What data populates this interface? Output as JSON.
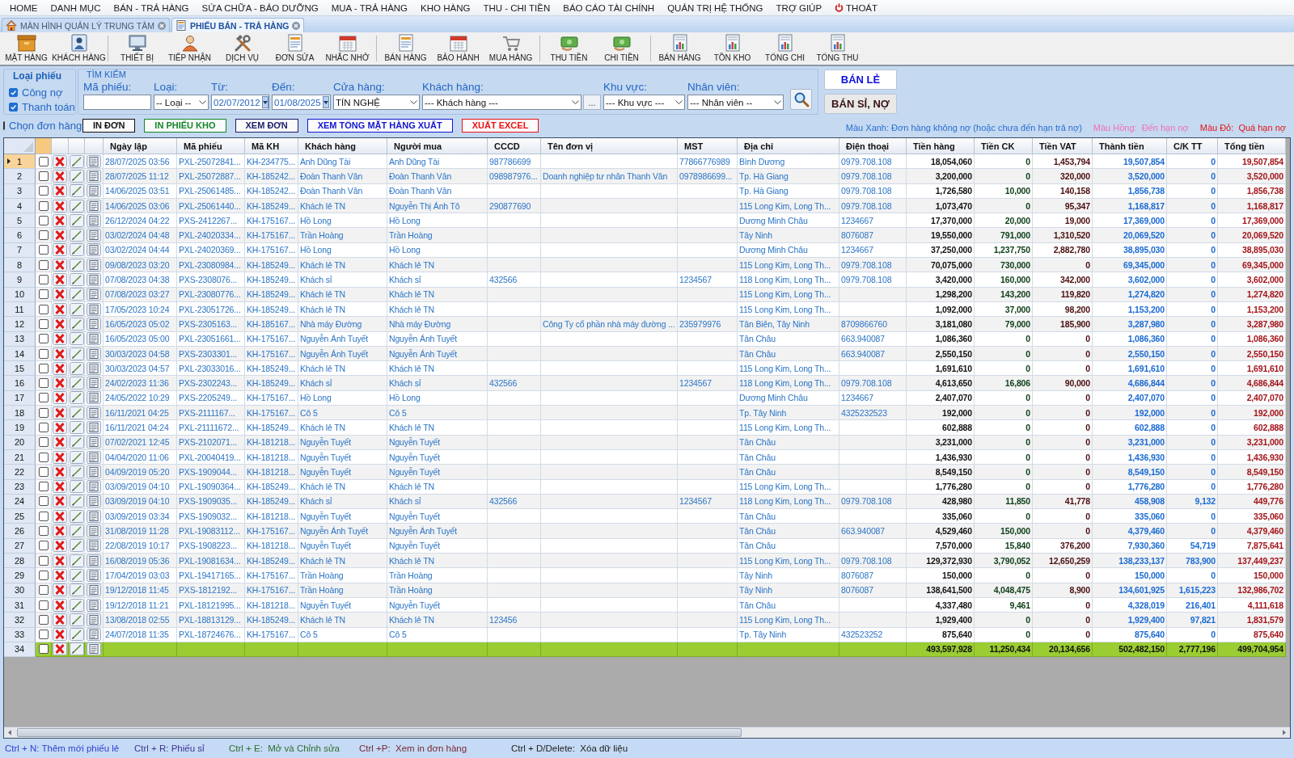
{
  "menu": [
    "HOME",
    "DANH MỤC",
    "BÁN - TRẢ HÀNG",
    "SỬA CHỮA - BẢO DƯỠNG",
    "MUA - TRẢ HÀNG",
    "KHO HÀNG",
    "THU - CHI TIỀN",
    "BÁO CÁO TÀI CHÍNH",
    "QUẢN TRỊ HỆ THỐNG",
    "TRỢ GIÚP"
  ],
  "exit": "THOÁT",
  "tabs": [
    {
      "label": "MÀN HÌNH QUẢN LÝ TRUNG TÂM",
      "selected": false
    },
    {
      "label": "PHIẾU BÁN - TRẢ HÀNG",
      "selected": true
    }
  ],
  "toolbar": [
    [
      "MẶT HÀNG",
      "KHÁCH HÀNG"
    ],
    [
      "THIẾT BỊ",
      "TIẾP NHẬN",
      "DỊCH VỤ",
      "ĐƠN SỬA",
      "NHẮC NHỞ"
    ],
    [
      "BÁN HÀNG",
      "BẢO HÀNH",
      "MUA HÀNG"
    ],
    [
      "THU TIỀN",
      "CHI TIỀN"
    ],
    [
      "BÁN HÀNG",
      "TỒN KHO",
      "TỔNG CHI",
      "TỔNG THU"
    ]
  ],
  "voucher_type": {
    "title": "Loại phiếu",
    "options": [
      {
        "label": "Công nợ",
        "checked": true
      },
      {
        "label": "Thanh toán",
        "checked": true
      }
    ]
  },
  "search": {
    "title": "TÌM KIẾM",
    "fields": [
      {
        "label": "Mã phiếu:",
        "kind": "text"
      },
      {
        "label": "Loại:",
        "kind": "select",
        "value": "-- Loại --"
      },
      {
        "label": "Từ:",
        "kind": "date",
        "value": "02/07/2012"
      },
      {
        "label": "Đến:",
        "kind": "date",
        "value": "01/08/2025"
      },
      {
        "label": "Cửa hàng:",
        "kind": "select",
        "value": "TÍN NGHỆ"
      },
      {
        "label": "Khách hàng:",
        "kind": "select_browse",
        "value": "--- Khách hàng ---",
        "browse": "..."
      },
      {
        "label": "Khu vực:",
        "kind": "select",
        "value": "--- Khu vực ---"
      },
      {
        "label": "Nhân viên:",
        "kind": "select",
        "value": "--- Nhân viên --"
      }
    ]
  },
  "mode_buttons": [
    "BÁN LẺ",
    "BÁN SỈ, NỢ"
  ],
  "select_orders": {
    "label": "Chọn đơn hàng",
    "checked": false
  },
  "actions": [
    {
      "label": "IN ĐƠN",
      "color": "#111111"
    },
    {
      "label": "IN PHIẾU KHO",
      "color": "#12862a"
    },
    {
      "label": "XEM ĐƠN",
      "color": "#1c1c6a"
    },
    {
      "label": "XEM TỔNG MẶT HÀNG XUẤT",
      "color": "#1414d2"
    },
    {
      "label": "XUẤT EXCEL",
      "color": "#ee1111"
    }
  ],
  "legend": [
    {
      "text": "Màu Xanh: Đơn hàng không nợ (hoặc chưa đến hạn trả nợ)",
      "color": "#2a6fd0"
    },
    {
      "text": "Màu Hồng:  Đến hạn nợ",
      "color": "#f070b0"
    },
    {
      "text": "Màu Đỏ:  Quá hạn nợ",
      "color": "#e01414"
    }
  ],
  "columns": [
    "Ngày lập",
    "Mã phiếu",
    "Mã KH",
    "Khách hàng",
    "Người mua",
    "CCCD",
    "Tên đơn vị",
    "MST",
    "Địa chỉ",
    "Điện thoại",
    "Tiền hàng",
    "Tiền CK",
    "Tiền VAT",
    "Thành tiền",
    "C/K TT",
    "Tổng tiền"
  ],
  "rows": [
    {
      "number": "1",
      "selected": true,
      "checked": false,
      "date": "28/07/2025 03:56",
      "voucher": "PXL-25072841...",
      "customer_code": "KH-234775...",
      "customer": "Anh Dũng Tài",
      "buyer": "Anh Dũng Tài",
      "cccd": "987786699",
      "tax_code": "77866776989",
      "address": "Bình Dương",
      "phone": "0979.708.108",
      "goods": "18,054,060",
      "discount": "0",
      "vat": "1,453,794",
      "amount": "19,507,854",
      "pay_discount": "0",
      "total": "19,507,854"
    },
    {
      "number": "2",
      "selected": false,
      "checked": false,
      "date": "28/07/2025 11:12",
      "voucher": "PXL-25072887...",
      "customer_code": "KH-185242...",
      "customer": "Đoàn Thanh Vân",
      "buyer": "Đoàn Thanh Vân",
      "cccd": "098987976...",
      "unit": "Doanh nghiệp tư nhân Thanh Vân",
      "tax_code": "0978986699...",
      "address": "Tp. Hà Giang",
      "phone": "0979.708.108",
      "goods": "3,200,000",
      "discount": "0",
      "vat": "320,000",
      "amount": "3,520,000",
      "pay_discount": "0",
      "total": "3,520,000"
    },
    {
      "number": "3",
      "selected": false,
      "checked": false,
      "date": "14/06/2025 03:51",
      "voucher": "PXL-25061485...",
      "customer_code": "KH-185242...",
      "customer": "Đoàn Thanh Vân",
      "buyer": "Đoàn Thanh Vân",
      "address": "Tp. Hà Giang",
      "phone": "0979.708.108",
      "goods": "1,726,580",
      "discount": "10,000",
      "vat": "140,158",
      "amount": "1,856,738",
      "pay_discount": "0",
      "total": "1,856,738"
    },
    {
      "number": "4",
      "selected": false,
      "checked": false,
      "date": "14/06/2025 03:06",
      "voucher": "PXL-25061440...",
      "customer_code": "KH-185249...",
      "customer": "Khách lẻ TN",
      "buyer": "Nguyễn Thị Ánh Tô",
      "cccd": "290877690",
      "address": "115 Long Kim, Long Th...",
      "phone": "0979.708.108",
      "goods": "1,073,470",
      "discount": "0",
      "vat": "95,347",
      "amount": "1,168,817",
      "pay_discount": "0",
      "total": "1,168,817"
    },
    {
      "number": "5",
      "selected": false,
      "checked": false,
      "date": "26/12/2024 04:22",
      "voucher": "PXS-2412267...",
      "customer_code": "KH-175167...",
      "customer": "Hồ Long",
      "buyer": "Hồ Long",
      "address": "Dương Minh Châu",
      "phone": "1234667",
      "goods": "17,370,000",
      "discount": "20,000",
      "vat": "19,000",
      "amount": "17,369,000",
      "pay_discount": "0",
      "total": "17,369,000"
    },
    {
      "number": "6",
      "selected": false,
      "checked": false,
      "date": "03/02/2024 04:48",
      "voucher": "PXL-24020334...",
      "customer_code": "KH-175167...",
      "customer": "Trần Hoàng",
      "buyer": "Trần Hoàng",
      "address": "Tây Ninh",
      "phone": "8076087",
      "goods": "19,550,000",
      "discount": "791,000",
      "vat": "1,310,520",
      "amount": "20,069,520",
      "pay_discount": "0",
      "total": "20,069,520"
    },
    {
      "number": "7",
      "selected": false,
      "checked": false,
      "date": "03/02/2024 04:44",
      "voucher": "PXL-24020369...",
      "customer_code": "KH-175167...",
      "customer": "Hồ Long",
      "buyer": "Hồ Long",
      "address": "Dương Minh Châu",
      "phone": "1234667",
      "goods": "37,250,000",
      "discount": "1,237,750",
      "vat": "2,882,780",
      "amount": "38,895,030",
      "pay_discount": "0",
      "total": "38,895,030"
    },
    {
      "number": "8",
      "selected": false,
      "checked": false,
      "date": "09/08/2023 03:20",
      "voucher": "PXL-23080984...",
      "customer_code": "KH-185249...",
      "customer": "Khách lẻ TN",
      "buyer": "Khách lẻ TN",
      "address": "115 Long Kim, Long Th...",
      "phone": "0979.708.108",
      "goods": "70,075,000",
      "discount": "730,000",
      "vat": "0",
      "amount": "69,345,000",
      "pay_discount": "0",
      "total": "69,345,000"
    },
    {
      "number": "9",
      "selected": false,
      "checked": false,
      "date": "07/08/2023 04:38",
      "voucher": "PXS-2308076...",
      "customer_code": "KH-185249...",
      "customer": "Khách sỉ",
      "buyer": "Khách sỉ",
      "cccd": "432566",
      "tax_code": "1234567",
      "address": "118 Long Kim, Long Th...",
      "phone": "0979.708.108",
      "goods": "3,420,000",
      "discount": "160,000",
      "vat": "342,000",
      "amount": "3,602,000",
      "pay_discount": "0",
      "total": "3,602,000"
    },
    {
      "number": "10",
      "selected": false,
      "checked": false,
      "date": "07/08/2023 03:27",
      "voucher": "PXL-23080776...",
      "customer_code": "KH-185249...",
      "customer": "Khách lẻ TN",
      "buyer": "Khách lẻ TN",
      "address": "115 Long Kim, Long Th...",
      "goods": "1,298,200",
      "discount": "143,200",
      "vat": "119,820",
      "amount": "1,274,820",
      "pay_discount": "0",
      "total": "1,274,820"
    },
    {
      "number": "11",
      "selected": false,
      "checked": false,
      "date": "17/05/2023 10:24",
      "voucher": "PXL-23051726...",
      "customer_code": "KH-185249...",
      "customer": "Khách lẻ TN",
      "buyer": "Khách lẻ TN",
      "address": "115 Long Kim, Long Th...",
      "goods": "1,092,000",
      "discount": "37,000",
      "vat": "98,200",
      "amount": "1,153,200",
      "pay_discount": "0",
      "total": "1,153,200"
    },
    {
      "number": "12",
      "selected": false,
      "checked": false,
      "date": "16/05/2023 05:02",
      "voucher": "PXS-2305163...",
      "customer_code": "KH-185167...",
      "customer": "Nhà máy Đường",
      "buyer": "Nhà máy Đường",
      "unit": "Công Ty cổ phần nhà máy đường ...",
      "tax_code": "235979976",
      "address": "Tân Biên, Tây Ninh",
      "phone": "8709866760",
      "goods": "3,181,080",
      "discount": "79,000",
      "vat": "185,900",
      "amount": "3,287,980",
      "pay_discount": "0",
      "total": "3,287,980"
    },
    {
      "number": "13",
      "selected": false,
      "checked": false,
      "date": "16/05/2023 05:00",
      "voucher": "PXL-23051661...",
      "customer_code": "KH-175167...",
      "customer": "Nguyễn Ánh Tuyết",
      "buyer": "Nguyễn Ánh Tuyết",
      "address": "Tân Châu",
      "phone": "663.940087",
      "goods": "1,086,360",
      "discount": "0",
      "vat": "0",
      "amount": "1,086,360",
      "pay_discount": "0",
      "total": "1,086,360"
    },
    {
      "number": "14",
      "selected": false,
      "checked": false,
      "date": "30/03/2023 04:58",
      "voucher": "PXS-2303301...",
      "customer_code": "KH-175167...",
      "customer": "Nguyễn Ánh Tuyết",
      "buyer": "Nguyễn Ánh Tuyết",
      "address": "Tân Châu",
      "phone": "663.940087",
      "goods": "2,550,150",
      "discount": "0",
      "vat": "0",
      "amount": "2,550,150",
      "pay_discount": "0",
      "total": "2,550,150"
    },
    {
      "number": "15",
      "selected": false,
      "checked": false,
      "date": "30/03/2023 04:57",
      "voucher": "PXL-23033016...",
      "customer_code": "KH-185249...",
      "customer": "Khách lẻ TN",
      "buyer": "Khách lẻ TN",
      "address": "115 Long Kim, Long Th...",
      "goods": "1,691,610",
      "discount": "0",
      "vat": "0",
      "amount": "1,691,610",
      "pay_discount": "0",
      "total": "1,691,610"
    },
    {
      "number": "16",
      "selected": false,
      "checked": false,
      "date": "24/02/2023 11:36",
      "voucher": "PXS-2302243...",
      "customer_code": "KH-185249...",
      "customer": "Khách sỉ",
      "buyer": "Khách sỉ",
      "cccd": "432566",
      "tax_code": "1234567",
      "address": "118 Long Kim, Long Th...",
      "phone": "0979.708.108",
      "goods": "4,613,650",
      "discount": "16,806",
      "vat": "90,000",
      "amount": "4,686,844",
      "pay_discount": "0",
      "total": "4,686,844"
    },
    {
      "number": "17",
      "selected": false,
      "checked": false,
      "date": "24/05/2022 10:29",
      "voucher": "PXS-2205249...",
      "customer_code": "KH-175167...",
      "customer": "Hồ Long",
      "buyer": "Hồ Long",
      "address": "Dương Minh Châu",
      "phone": "1234667",
      "goods": "2,407,070",
      "discount": "0",
      "vat": "0",
      "amount": "2,407,070",
      "pay_discount": "0",
      "total": "2,407,070"
    },
    {
      "number": "18",
      "selected": false,
      "checked": false,
      "date": "16/11/2021 04:25",
      "voucher": "PXS-2111167...",
      "customer_code": "KH-175167...",
      "customer": "Cô 5",
      "buyer": "Cô 5",
      "address": "Tp. Tây Ninh",
      "phone": "4325232523",
      "goods": "192,000",
      "discount": "0",
      "vat": "0",
      "amount": "192,000",
      "pay_discount": "0",
      "total": "192,000"
    },
    {
      "number": "19",
      "selected": false,
      "checked": false,
      "date": "16/11/2021 04:24",
      "voucher": "PXL-21111672...",
      "customer_code": "KH-185249...",
      "customer": "Khách lẻ TN",
      "buyer": "Khách lẻ TN",
      "address": "115 Long Kim, Long Th...",
      "goods": "602,888",
      "discount": "0",
      "vat": "0",
      "amount": "602,888",
      "pay_discount": "0",
      "total": "602,888"
    },
    {
      "number": "20",
      "selected": false,
      "checked": false,
      "date": "07/02/2021 12:45",
      "voucher": "PXS-2102071...",
      "customer_code": "KH-181218...",
      "customer": "Nguyễn Tuyết",
      "buyer": "Nguyễn Tuyết",
      "address": "Tân Châu",
      "goods": "3,231,000",
      "discount": "0",
      "vat": "0",
      "amount": "3,231,000",
      "pay_discount": "0",
      "total": "3,231,000"
    },
    {
      "number": "21",
      "selected": false,
      "checked": false,
      "date": "04/04/2020 11:06",
      "voucher": "PXL-20040419...",
      "customer_code": "KH-181218...",
      "customer": "Nguyễn Tuyết",
      "buyer": "Nguyễn Tuyết",
      "address": "Tân Châu",
      "goods": "1,436,930",
      "discount": "0",
      "vat": "0",
      "amount": "1,436,930",
      "pay_discount": "0",
      "total": "1,436,930"
    },
    {
      "number": "22",
      "selected": false,
      "checked": false,
      "date": "04/09/2019 05:20",
      "voucher": "PXS-1909044...",
      "customer_code": "KH-181218...",
      "customer": "Nguyễn Tuyết",
      "buyer": "Nguyễn Tuyết",
      "address": "Tân Châu",
      "goods": "8,549,150",
      "discount": "0",
      "vat": "0",
      "amount": "8,549,150",
      "pay_discount": "0",
      "total": "8,549,150"
    },
    {
      "number": "23",
      "selected": false,
      "checked": false,
      "date": "03/09/2019 04:10",
      "voucher": "PXL-19090364...",
      "customer_code": "KH-185249...",
      "customer": "Khách lẻ TN",
      "buyer": "Khách lẻ TN",
      "address": "115 Long Kim, Long Th...",
      "goods": "1,776,280",
      "discount": "0",
      "vat": "0",
      "amount": "1,776,280",
      "pay_discount": "0",
      "total": "1,776,280"
    },
    {
      "number": "24",
      "selected": false,
      "checked": false,
      "date": "03/09/2019 04:10",
      "voucher": "PXS-1909035...",
      "customer_code": "KH-185249...",
      "customer": "Khách sỉ",
      "buyer": "Khách sỉ",
      "cccd": "432566",
      "tax_code": "1234567",
      "address": "118 Long Kim, Long Th...",
      "phone": "0979.708.108",
      "goods": "428,980",
      "discount": "11,850",
      "vat": "41,778",
      "amount": "458,908",
      "pay_discount": "9,132",
      "total": "449,776"
    },
    {
      "number": "25",
      "selected": false,
      "checked": false,
      "date": "03/09/2019 03:34",
      "voucher": "PXS-1909032...",
      "customer_code": "KH-181218...",
      "customer": "Nguyễn Tuyết",
      "buyer": "Nguyễn Tuyết",
      "address": "Tân Châu",
      "goods": "335,060",
      "discount": "0",
      "vat": "0",
      "amount": "335,060",
      "pay_discount": "0",
      "total": "335,060"
    },
    {
      "number": "26",
      "selected": false,
      "checked": false,
      "date": "31/08/2019 11:28",
      "voucher": "PXL-19083112...",
      "customer_code": "KH-175167...",
      "customer": "Nguyễn Ánh Tuyết",
      "buyer": "Nguyễn Ánh Tuyết",
      "address": "Tân Châu",
      "phone": "663.940087",
      "goods": "4,529,460",
      "discount": "150,000",
      "vat": "0",
      "amount": "4,379,460",
      "pay_discount": "0",
      "total": "4,379,460"
    },
    {
      "number": "27",
      "selected": false,
      "checked": false,
      "date": "22/08/2019 10:17",
      "voucher": "PXS-1908223...",
      "customer_code": "KH-181218...",
      "customer": "Nguyễn Tuyết",
      "buyer": "Nguyễn Tuyết",
      "address": "Tân Châu",
      "goods": "7,570,000",
      "discount": "15,840",
      "vat": "376,200",
      "amount": "7,930,360",
      "pay_discount": "54,719",
      "total": "7,875,641"
    },
    {
      "number": "28",
      "selected": false,
      "checked": false,
      "date": "16/08/2019 05:36",
      "voucher": "PXL-19081634...",
      "customer_code": "KH-185249...",
      "customer": "Khách lẻ TN",
      "buyer": "Khách lẻ TN",
      "address": "115 Long Kim, Long Th...",
      "phone": "0979.708.108",
      "goods": "129,372,930",
      "discount": "3,790,052",
      "vat": "12,650,259",
      "amount": "138,233,137",
      "pay_discount": "783,900",
      "total": "137,449,237"
    },
    {
      "number": "29",
      "selected": false,
      "checked": false,
      "date": "17/04/2019 03:03",
      "voucher": "PXL-19417165...",
      "customer_code": "KH-175167...",
      "customer": "Trần Hoàng",
      "buyer": "Trần Hoàng",
      "address": "Tây Ninh",
      "phone": "8076087",
      "goods": "150,000",
      "discount": "0",
      "vat": "0",
      "amount": "150,000",
      "pay_discount": "0",
      "total": "150,000"
    },
    {
      "number": "30",
      "selected": false,
      "checked": false,
      "date": "19/12/2018 11:45",
      "voucher": "PXS-1812192...",
      "customer_code": "KH-175167...",
      "customer": "Trần Hoàng",
      "buyer": "Trần Hoàng",
      "address": "Tây Ninh",
      "phone": "8076087",
      "goods": "138,641,500",
      "discount": "4,048,475",
      "vat": "8,900",
      "amount": "134,601,925",
      "pay_discount": "1,615,223",
      "total": "132,986,702"
    },
    {
      "number": "31",
      "selected": false,
      "checked": false,
      "date": "19/12/2018 11:21",
      "voucher": "PXL-18121995...",
      "customer_code": "KH-181218...",
      "customer": "Nguyễn Tuyết",
      "buyer": "Nguyễn Tuyết",
      "address": "Tân Châu",
      "goods": "4,337,480",
      "discount": "9,461",
      "vat": "0",
      "amount": "4,328,019",
      "pay_discount": "216,401",
      "total": "4,111,618"
    },
    {
      "number": "32",
      "selected": false,
      "checked": false,
      "date": "13/08/2018 02:55",
      "voucher": "PXL-18813129...",
      "customer_code": "KH-185249...",
      "customer": "Khách lẻ TN",
      "buyer": "Khách lẻ TN",
      "cccd": "123456",
      "address": "115 Long Kim, Long Th...",
      "goods": "1,929,400",
      "discount": "0",
      "vat": "0",
      "amount": "1,929,400",
      "pay_discount": "97,821",
      "total": "1,831,579"
    },
    {
      "number": "33",
      "selected": false,
      "checked": false,
      "date": "24/07/2018 11:35",
      "voucher": "PXL-18724676...",
      "customer_code": "KH-175167...",
      "customer": "Cô 5",
      "buyer": "Cô 5",
      "address": "Tp. Tây Ninh",
      "phone": "432523252",
      "goods": "875,640",
      "discount": "0",
      "vat": "0",
      "amount": "875,640",
      "pay_discount": "0",
      "total": "875,640"
    }
  ],
  "totals": {
    "number": "34",
    "selected": false,
    "checked": false,
    "goods": "493,597,928",
    "discount": "11,250,434",
    "vat": "20,134,656",
    "amount": "502,482,150",
    "pay_discount": "2,777,196",
    "total": "499,704,954"
  },
  "shortcuts": [
    {
      "text": "Ctrl + N: Thêm mới phiếu lẻ",
      "color": "#2e3fd0"
    },
    {
      "text": "Ctrl + R: Phiếu sỉ",
      "color": "#3c3494"
    },
    {
      "text": "Ctrl + E:  Mở và Chỉnh sửa",
      "color": "#2e6e2e"
    },
    {
      "text": "Ctrl +P:  Xem in đơn hàng",
      "color": "#7a2a34"
    },
    {
      "text": "Ctrl + D/Delete:  Xóa dữ liệu",
      "color": "#222222"
    }
  ]
}
